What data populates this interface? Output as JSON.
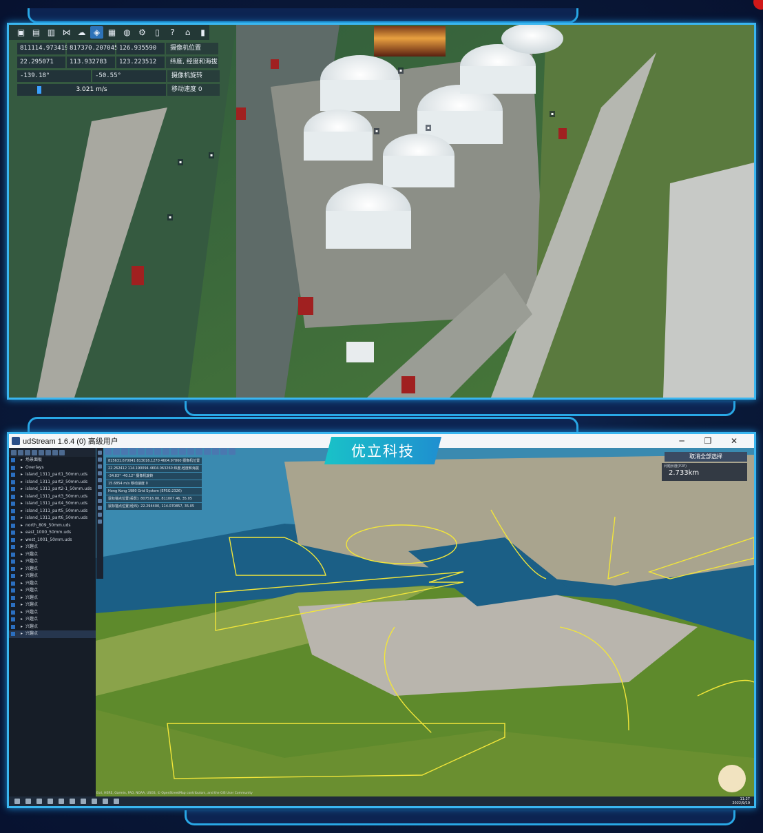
{
  "top_panel": {
    "toolbar": [
      {
        "icon": "folder-open-icon"
      },
      {
        "icon": "folder-icon"
      },
      {
        "icon": "save-icon"
      },
      {
        "icon": "share-icon"
      },
      {
        "icon": "cloud-icon"
      },
      {
        "icon": "layers-icon"
      },
      {
        "icon": "tile-icon"
      },
      {
        "icon": "globe-icon"
      },
      {
        "icon": "gear-icon"
      },
      {
        "icon": "book-icon"
      },
      {
        "icon": "help-icon"
      },
      {
        "icon": "home-icon"
      },
      {
        "icon": "bookmark-icon"
      }
    ],
    "camera": {
      "position": [
        "811114.973419",
        "817370.207045",
        "126.935590"
      ],
      "position_label": "摄像机位置",
      "latlon": [
        "22.295071",
        "113.932783",
        "123.223512"
      ],
      "latlon_label": "纬度, 经度和海拔",
      "rotation": [
        "-139.18°",
        "-50.55°"
      ],
      "rotation_label": "摄像机旋转",
      "speed": "3.021 m/s",
      "speed_fraction": 0.14,
      "speed_label": "移动速度 0"
    }
  },
  "bottom_panel": {
    "window_title": "udStream 1.6.4 (0) 高级用户",
    "window_controls": {
      "minimize": "─",
      "maximize": "❐",
      "close": "✕"
    },
    "brand": "优立科技",
    "cancel_select": "取消全部选择",
    "distance_label": "问题长度(P2P)",
    "distance_value": "2.733km",
    "sidebar_items": [
      "场景面板",
      "Overlays",
      "island_1311_part1_50mm.uds",
      "island_1311_part2_50mm.uds",
      "island_1311_part2-1_50mm.uds",
      "island_1311_part3_50mm.uds",
      "island_1311_part4_50mm.uds",
      "island_1311_part5_50mm.uds",
      "island_1311_part6_50mm.uds",
      "north_809_50mm.uds",
      "east_1000_50mm.uds",
      "west_1001_50mm.uds",
      "兴趣点",
      "兴趣点",
      "兴趣点",
      "兴趣点",
      "兴趣点",
      "兴趣点",
      "兴趣点",
      "兴趣点",
      "兴趣点",
      "兴趣点",
      "兴趣点",
      "兴趣点",
      "兴趣点"
    ],
    "mini_data": [
      "815631.670041   813016.1270 4604.97860   摄像机位置",
      "22.262412  114.190094  4604.063260   纬度,经度和海拔",
      "-34.83°   -40.12°   摄像机旋转",
      "15.6854 m/s   移动速度 0",
      "Hong Kong 1980 Grid System (EPSG:2326)",
      "鼠标锚点位置(投影): 807516.00, 811007.46, 35.05",
      "鼠标锚点位置(经纬): 22.294400, 114.070857, 35.05"
    ],
    "attribution": "Esri, HERE, Garmin, FAO, NOAA, USGS, © OpenStreetMap contributors, and the GIS User Community",
    "clock": [
      "11:27",
      "2022/9/19"
    ]
  }
}
